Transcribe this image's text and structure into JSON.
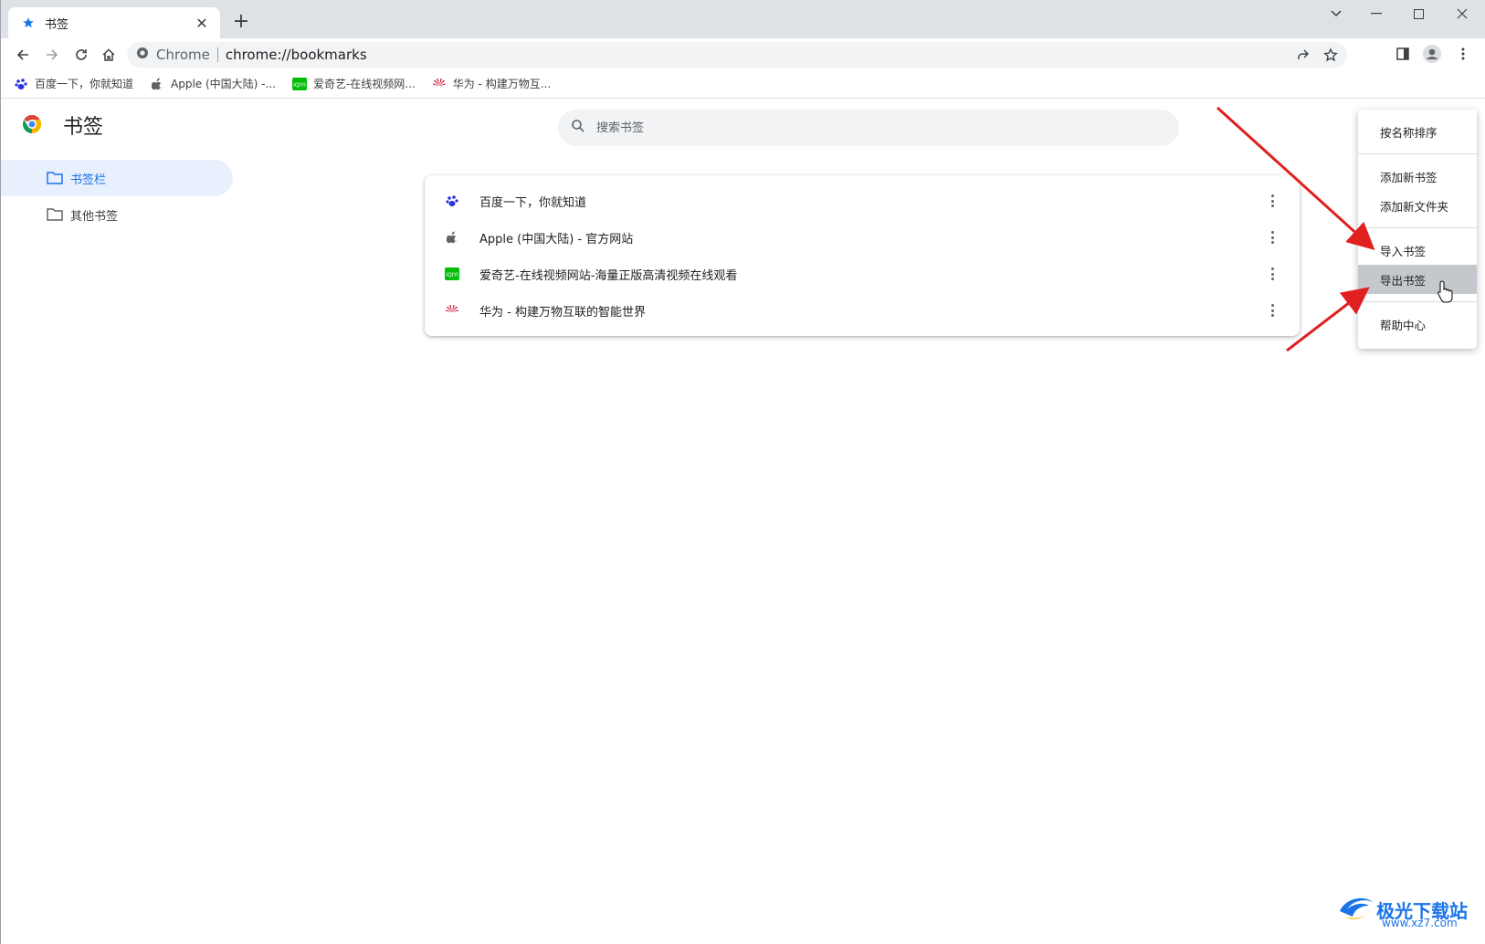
{
  "tab": {
    "title": "书签"
  },
  "toolbar": {
    "scheme": "Chrome",
    "url": "chrome://bookmarks"
  },
  "bookmarks_bar": [
    {
      "label": "百度一下，你就知道",
      "icon": "baidu-icon"
    },
    {
      "label": "Apple (中国大陆) -...",
      "icon": "apple-icon"
    },
    {
      "label": "爱奇艺-在线视频网...",
      "icon": "iqiyi-icon"
    },
    {
      "label": "华为 - 构建万物互...",
      "icon": "huawei-icon"
    }
  ],
  "page": {
    "title": "书签",
    "search_placeholder": "搜索书签"
  },
  "sidebar": {
    "items": [
      {
        "label": "书签栏"
      },
      {
        "label": "其他书签"
      }
    ]
  },
  "bookmarks": [
    {
      "label": "百度一下，你就知道",
      "icon": "baidu-icon"
    },
    {
      "label": "Apple (中国大陆) - 官方网站",
      "icon": "apple-icon"
    },
    {
      "label": "爱奇艺-在线视频网站-海量正版高清视频在线观看",
      "icon": "iqiyi-icon"
    },
    {
      "label": "华为 - 构建万物互联的智能世界",
      "icon": "huawei-icon"
    }
  ],
  "menu": {
    "sort": "按名称排序",
    "add_bookmark": "添加新书签",
    "add_folder": "添加新文件夹",
    "import": "导入书签",
    "export": "导出书签",
    "help": "帮助中心"
  },
  "watermark": {
    "brand": "极光下载站",
    "site": "www.xz7.com"
  },
  "colors": {
    "accent": "#1a73e8",
    "arrow": "#e02020",
    "highlight": "#c4c7cc"
  }
}
